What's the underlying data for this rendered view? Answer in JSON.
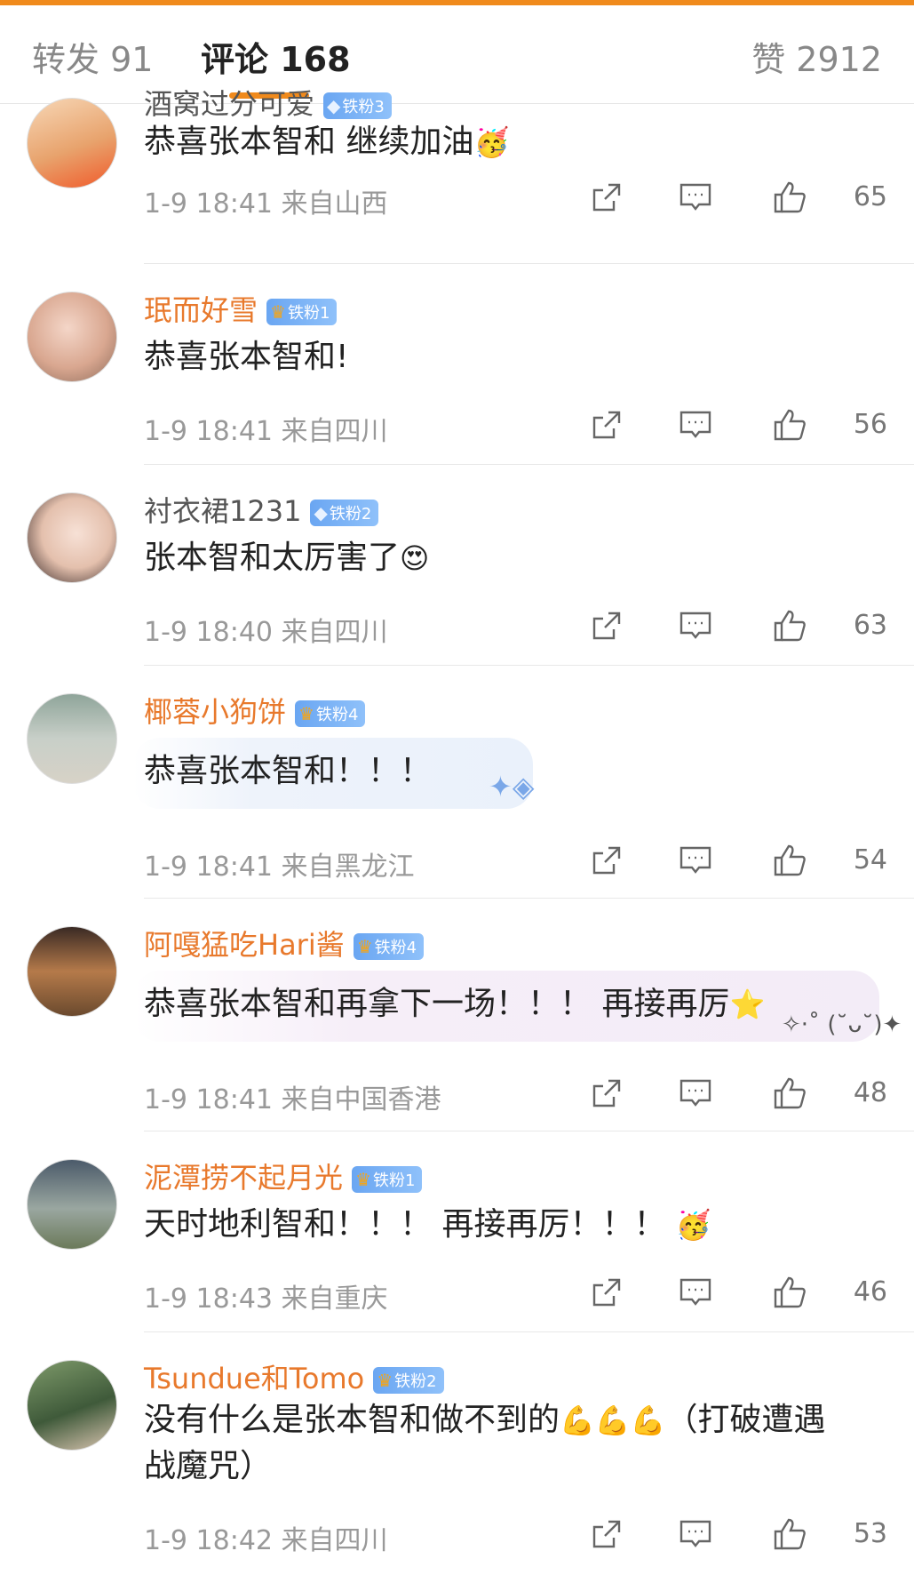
{
  "tabs": {
    "repost": "转发 91",
    "comments": "评论 168",
    "likes": "赞 2912"
  },
  "comments": [
    {
      "username": "酒窝过分可爱",
      "badge": "铁粉3",
      "badge_icon": "diamond-icon",
      "name_color": "gray",
      "text": "恭喜张本智和 继续加油",
      "emoji": "🥳",
      "time": "1-9 18:41",
      "location": "来自山西",
      "likes": "65"
    },
    {
      "username": "珉而好雪",
      "badge": "铁粉1",
      "badge_icon": "crown-icon",
      "name_color": "orange",
      "text": "恭喜张本智和!",
      "emoji": "",
      "time": "1-9 18:41",
      "location": "来自四川",
      "likes": "56"
    },
    {
      "username": "衬衣裙1231",
      "badge": "铁粉2",
      "badge_icon": "diamond-icon",
      "name_color": "gray",
      "text": "张本智和太厉害了",
      "emoji": "😍",
      "time": "1-9 18:40",
      "location": "来自四川",
      "likes": "63"
    },
    {
      "username": "椰蓉小狗饼",
      "badge": "铁粉4",
      "badge_icon": "crown-icon",
      "name_color": "orange",
      "text": "恭喜张本智和！！！",
      "emoji": "",
      "time": "1-9 18:41",
      "location": "来自黑龙江",
      "likes": "54"
    },
    {
      "username": "阿嘎猛吃Hari酱",
      "badge": "铁粉4",
      "badge_icon": "crown-icon",
      "name_color": "orange",
      "text": "恭喜张本智和再拿下一场！！！ 再接再厉",
      "emoji": "⭐",
      "time": "1-9 18:41",
      "location": "来自中国香港",
      "likes": "48"
    },
    {
      "username": "泥潭捞不起月光",
      "badge": "铁粉1",
      "badge_icon": "crown-icon",
      "name_color": "orange",
      "text": "天时地利智和！！！ 再接再厉！！！",
      "emoji": "🥳",
      "time": "1-9 18:43",
      "location": "来自重庆",
      "likes": "46"
    },
    {
      "username": "Tsundue和Tomo",
      "badge": "铁粉2",
      "badge_icon": "crown-icon",
      "name_color": "orange",
      "text_line1": "没有什么是张本智和做不到的",
      "emoji": "💪💪💪",
      "text_line1_after": "（打破遭遇",
      "text_line2": "战魔咒）",
      "time": "1-9 18:42",
      "location": "来自四川",
      "likes": "53"
    }
  ],
  "colors": {
    "accent": "#f08a1c",
    "username_orange": "#e8792c",
    "badge_blue": "#6aa6f2"
  }
}
